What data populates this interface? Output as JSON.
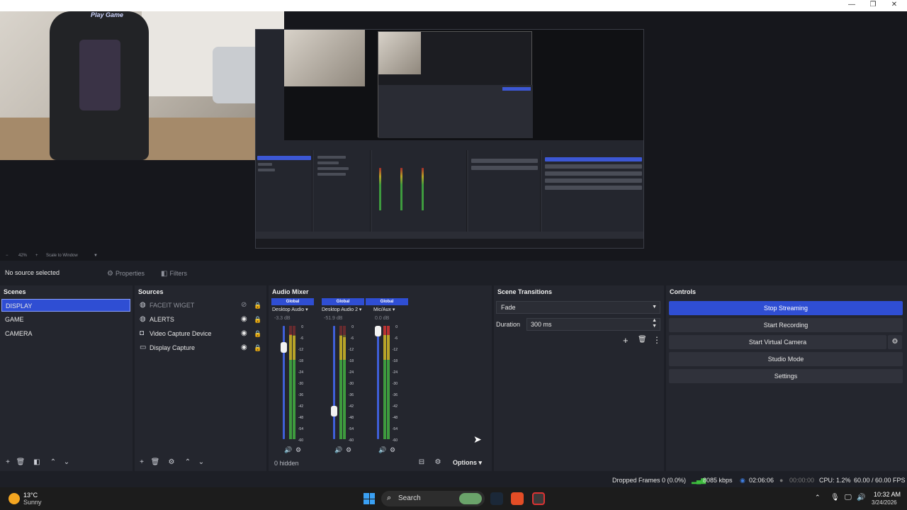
{
  "titlebar": {
    "minimize_icon": "—",
    "maximize_icon": "❐",
    "close_icon": "✕"
  },
  "zoom_bar": {
    "zoom_out": "−",
    "zoom_level": "42%",
    "zoom_in": "+",
    "scale_mode": "Scale to Window",
    "caret": "▼"
  },
  "source_toolbar": {
    "status": "No source selected",
    "properties_label": "Properties",
    "filters_label": "Filters"
  },
  "scenes": {
    "title": "Scenes",
    "items": [
      "DISPLAY",
      "GAME",
      "CAMERA"
    ],
    "active_index": 0
  },
  "sources": {
    "title": "Sources",
    "items": [
      {
        "label": "FACEIT WIGET",
        "icon": "globe-icon",
        "visible": false
      },
      {
        "label": "ALERTS",
        "icon": "globe-icon",
        "visible": true
      },
      {
        "label": "Video Capture Device",
        "icon": "camera-icon",
        "visible": true
      },
      {
        "label": "Display Capture",
        "icon": "monitor-icon",
        "visible": true
      }
    ]
  },
  "audio_mixer": {
    "title": "Audio Mixer",
    "channels": [
      {
        "head": "Global",
        "name": "Desktop Audio",
        "db": "-3.3 dB",
        "volume": 0.84
      },
      {
        "head": "Global",
        "name": "Desktop Audio 2",
        "db": "-51.9 dB",
        "volume": 0.22
      },
      {
        "head": "Global",
        "name": "Mic/Aux",
        "db": "0.0 dB",
        "volume": 1.0
      }
    ],
    "scale": [
      "0",
      "-6",
      "-12",
      "-18",
      "-24",
      "-30",
      "-36",
      "-42",
      "-48",
      "-54",
      "-60"
    ],
    "hidden_label": "0 hidden",
    "options_label": "Options"
  },
  "scene_transitions": {
    "title": "Scene Transitions",
    "transition": "Fade",
    "duration_label": "Duration",
    "duration_value": "300 ms"
  },
  "controls": {
    "title": "Controls",
    "stop_streaming": "Stop Streaming",
    "start_recording": "Start Recording",
    "start_virtual_camera": "Start Virtual Camera",
    "studio_mode": "Studio Mode",
    "settings": "Settings"
  },
  "statusbar": {
    "dropped_frames": "Dropped Frames 0 (0.0%)",
    "bitrate": "8085 kbps",
    "stream_time": "02:06:06",
    "record_time": "00:00:00",
    "cpu": "CPU: 1.2%",
    "fps": "60.00 / 60.00 FPS"
  },
  "taskbar": {
    "temperature": "13°C",
    "condition": "Sunny",
    "search_placeholder": "Search",
    "time": "10:32 AM",
    "date": "3/24/2026"
  },
  "webcam": {
    "logo_text": "Play Game"
  },
  "colors": {
    "accent": "#2f4ed3",
    "panel": "#24262e",
    "background": "#1d1f26"
  }
}
